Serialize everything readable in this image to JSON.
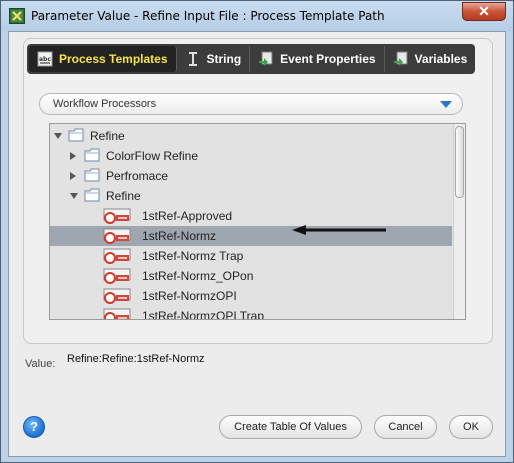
{
  "window": {
    "title": "Parameter Value - Refine Input File : Process Template Path",
    "close_label": "✕"
  },
  "tabs": [
    {
      "label": "Process Templates",
      "icon": "abc-list-icon",
      "active": true
    },
    {
      "label": "String",
      "icon": "text-cursor-icon",
      "active": false
    },
    {
      "label": "Event Properties",
      "icon": "event-arrow-icon",
      "active": false
    },
    {
      "label": "Variables",
      "icon": "variables-arrow-icon",
      "active": false
    }
  ],
  "dropdown": {
    "selected": "Workflow Processors"
  },
  "tree": {
    "rows": [
      {
        "label": "Refine",
        "type": "folder",
        "expanded": true,
        "level": 0
      },
      {
        "label": "ColorFlow Refine",
        "type": "folder",
        "expanded": false,
        "level": 1
      },
      {
        "label": "Perfromace",
        "type": "folder",
        "expanded": false,
        "level": 1
      },
      {
        "label": "Refine",
        "type": "folder",
        "expanded": true,
        "level": 1
      },
      {
        "label": "1stRef-Approved",
        "type": "process",
        "level": 2
      },
      {
        "label": "1stRef-Normz",
        "type": "process",
        "level": 2,
        "selected": true
      },
      {
        "label": "1stRef-Normz Trap",
        "type": "process",
        "level": 2
      },
      {
        "label": "1stRef-Normz_OPon",
        "type": "process",
        "level": 2
      },
      {
        "label": "1stRef-NormzOPI",
        "type": "process",
        "level": 2
      },
      {
        "label": "1stRef-NormzOPI Trap",
        "type": "process",
        "level": 2
      }
    ]
  },
  "value": {
    "label": "Value:",
    "text": "Refine:Refine:1stRef-Normz"
  },
  "buttons": {
    "help": "?",
    "create_table": "Create Table Of Values",
    "cancel": "Cancel",
    "ok": "OK"
  },
  "colors": {
    "active_tab_text": "#f7e34a",
    "tab_bar": "#3c3c3c",
    "selected_row": "#9ea6b0",
    "dropdown_arrow": "#2a76c6"
  }
}
